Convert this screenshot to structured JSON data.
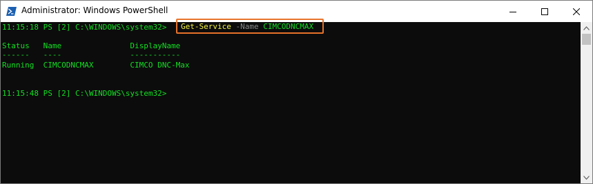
{
  "window": {
    "title": "Administrator: Windows PowerShell",
    "icon": "powershell-icon"
  },
  "controls": {
    "minimize_icon": "minimize-icon",
    "maximize_icon": "maximize-icon",
    "close_icon": "close-icon"
  },
  "console": {
    "prompt1": "11:15:18 PS [2] C:\\WINDOWS\\system32>",
    "command": {
      "cmdlet": "Get-Service",
      "parameter": "-Name",
      "argument": "CIMCODNCMAX"
    },
    "header": "Status   Name               DisplayName",
    "separator": "------   ----               -----------",
    "row": "Running  CIMCODNCMAX        CIMCO DNC-Max",
    "prompt2": "11:15:48 PS [2] C:\\WINDOWS\\system32>"
  },
  "colors": {
    "background": "#0c0c0c",
    "text": "#13e023",
    "cmdlet": "#f5f543",
    "parameter": "#8a8a8a",
    "highlight_box": "#e8732a"
  }
}
